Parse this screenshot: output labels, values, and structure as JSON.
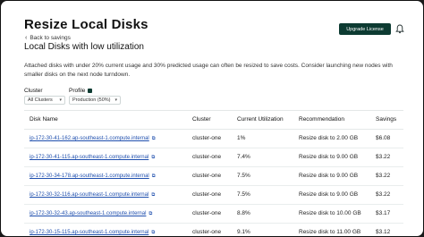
{
  "page": {
    "title": "Resize Local Disks",
    "back_label": "Back to savings",
    "upgrade_label": "Upgrade License",
    "section_title": "Local Disks with low utilization",
    "description": "Attached disks with under 20% current usage and 30% predicted usage can often be resized to save costs. Consider launching new nodes with smaller disks on the next node turndown."
  },
  "filters": {
    "cluster_label": "Cluster",
    "cluster_value": "All Clusters",
    "profile_label": "Profile",
    "profile_value": "Production (50%)"
  },
  "table": {
    "headers": {
      "name": "Disk Name",
      "cluster": "Cluster",
      "utilization": "Current Utilization",
      "recommendation": "Recommendation",
      "savings": "Savings"
    },
    "rows": [
      {
        "name": "ip-172-30-41-162.ap-southeast-1.compute.internal",
        "cluster": "cluster-one",
        "utilization": "1%",
        "recommendation": "Resize disk to 2.00 GB",
        "savings": "$6.08"
      },
      {
        "name": "ip-172-30-41-115.ap-southeast-1.compute.internal",
        "cluster": "cluster-one",
        "utilization": "7.4%",
        "recommendation": "Resize disk to 9.00 GB",
        "savings": "$3.22"
      },
      {
        "name": "ip-172-30-34-178.ap-southeast-1.compute.internal",
        "cluster": "cluster-one",
        "utilization": "7.5%",
        "recommendation": "Resize disk to 9.00 GB",
        "savings": "$3.22"
      },
      {
        "name": "ip-172-30-32-116.ap-southeast-1.compute.internal",
        "cluster": "cluster-one",
        "utilization": "7.5%",
        "recommendation": "Resize disk to 9.00 GB",
        "savings": "$3.22"
      },
      {
        "name": "ip-172-30-32-43.ap-southeast-1.compute.internal",
        "cluster": "cluster-one",
        "utilization": "8.8%",
        "recommendation": "Resize disk to 10.00 GB",
        "savings": "$3.17"
      },
      {
        "name": "ip-172-30-15-115.ap-southeast-1.compute.internal",
        "cluster": "cluster-one",
        "utilization": "9.1%",
        "recommendation": "Resize disk to 11.00 GB",
        "savings": "$3.12"
      }
    ]
  },
  "icons": {
    "back": "chevron-left-icon",
    "notifications": "bell-icon",
    "profile_info": "info-icon",
    "dropdown": "chevron-down-icon",
    "external_link": "external-link-icon"
  },
  "colors": {
    "accent": "#0d3b32",
    "link": "#1f4fae"
  }
}
